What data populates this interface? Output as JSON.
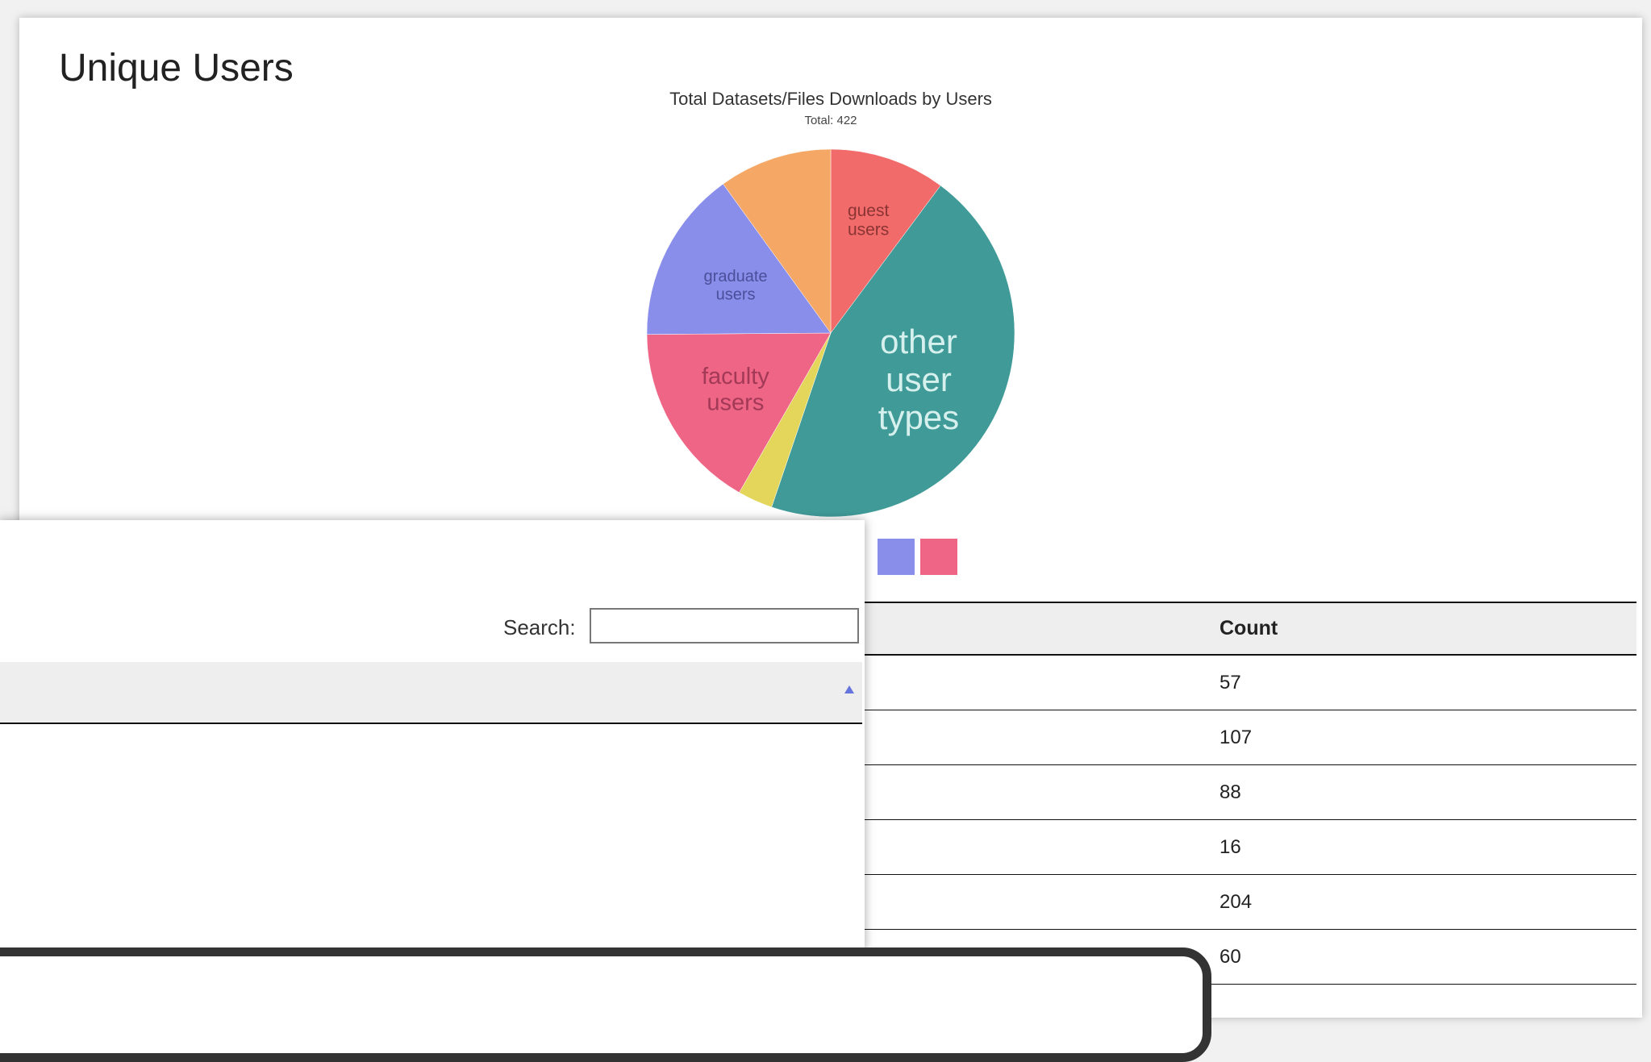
{
  "page": {
    "title": "Unique Users"
  },
  "chart_data": {
    "type": "pie",
    "title": "Total Datasets/Files Downloads by Users",
    "subtitle": "Total: 422",
    "slices": [
      {
        "label": "guest users",
        "value": 43,
        "color": "#f26b6b"
      },
      {
        "label": "other user types",
        "value": 190,
        "color": "#409b98"
      },
      {
        "label": "",
        "value": 13,
        "color": "#e3d65a"
      },
      {
        "label": "faculty users",
        "value": 70,
        "color": "#ef6586"
      },
      {
        "label": "graduate users",
        "value": 64,
        "color": "#8a8eeb"
      },
      {
        "label": "",
        "value": 42,
        "color": "#f5a866"
      }
    ]
  },
  "legend": {
    "colors": [
      "#409b98",
      "#8a8eeb",
      "#ef6586"
    ]
  },
  "table": {
    "columns": [
      "",
      "Count"
    ],
    "rows": [
      {
        "cells": [
          "",
          "57"
        ]
      },
      {
        "cells": [
          "",
          "107"
        ]
      },
      {
        "cells": [
          "",
          "88"
        ]
      },
      {
        "cells": [
          "",
          "16"
        ]
      },
      {
        "cells": [
          "",
          "204"
        ]
      },
      {
        "cells": [
          "",
          "60"
        ]
      }
    ]
  },
  "popup": {
    "search_label": "Search:",
    "search_value": ""
  }
}
